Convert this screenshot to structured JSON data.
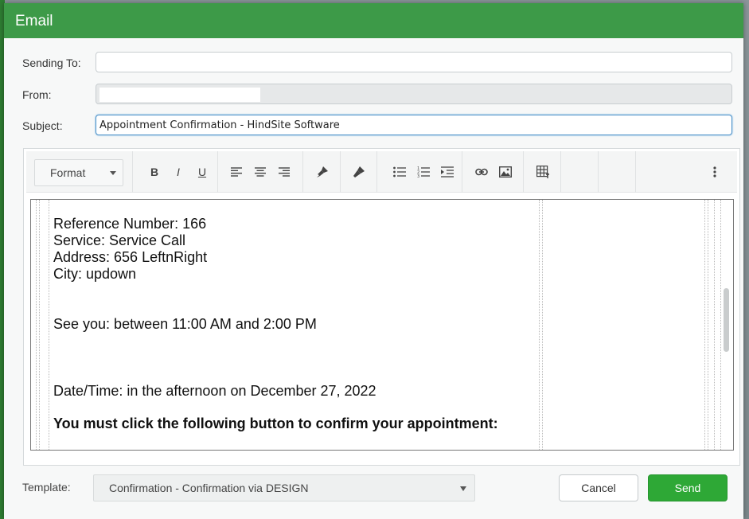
{
  "dialog": {
    "title": "Email"
  },
  "form": {
    "sending_to_label": "Sending To:",
    "sending_to_value": "",
    "from_label": "From:",
    "from_value": "",
    "subject_label": "Subject:",
    "subject_value": "Appointment Confirmation - HindSite Software"
  },
  "toolbar": {
    "format_label": "Format",
    "buttons": [
      "bold-icon",
      "italic-icon",
      "underline-icon",
      "align-left-icon",
      "align-center-icon",
      "align-right-icon",
      "format-painter-icon",
      "clear-format-icon",
      "bullet-list-icon",
      "numbered-list-icon",
      "indent-icon",
      "link-icon",
      "image-icon",
      "table-icon",
      "more-icon"
    ],
    "bold_glyph": "B",
    "italic_glyph": "I",
    "underline_glyph": "U"
  },
  "email_body": {
    "lines": [
      "Reference Number: 166",
      "Service: Service Call",
      "Address: 656 LeftnRight",
      "City: updown",
      "See you: between 11:00 AM and 2:00 PM",
      "Date/Time: in the afternoon on December 27, 2022",
      "You must click the following button to confirm your appointment:"
    ]
  },
  "footer": {
    "template_label": "Template:",
    "template_value": "Confirmation - Confirmation via DESIGN",
    "cancel_label": "Cancel",
    "send_label": "Send"
  },
  "colors": {
    "header": "#3d9a48",
    "send_button": "#2ea836",
    "focus_border": "#4a90c8"
  }
}
